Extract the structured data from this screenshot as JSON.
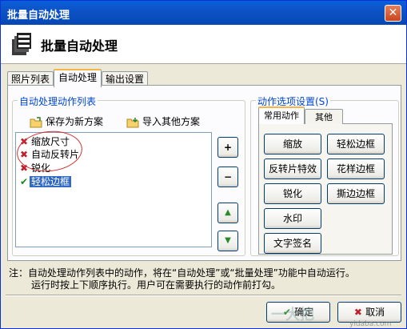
{
  "window": {
    "title": "批量自动处理",
    "close_glyph": "✕"
  },
  "header": {
    "title": "批量自动处理",
    "icon": "batch-process-icon"
  },
  "tabs": [
    {
      "label": "照片列表",
      "active": false
    },
    {
      "label": "自动处理",
      "active": true
    },
    {
      "label": "输出设置",
      "active": false
    }
  ],
  "left_group": {
    "legend": "自动处理动作列表",
    "save_label": "保存为新方案",
    "import_label": "导入其他方案",
    "actions": [
      {
        "label": "缩放尺寸",
        "status": "disabled",
        "mark": "✖"
      },
      {
        "label": "自动反转片",
        "status": "disabled",
        "mark": "✖"
      },
      {
        "label": "锐化",
        "status": "disabled",
        "mark": "✖"
      },
      {
        "label": "轻松边框",
        "status": "enabled",
        "mark": "✔",
        "selected": true
      }
    ],
    "side_buttons": {
      "add": "+",
      "remove": "−",
      "up": "▲",
      "down": "▼"
    }
  },
  "right_group": {
    "legend": "动作选项设置(S)",
    "subtabs": [
      {
        "label": "常用动作",
        "active": true
      },
      {
        "label": "其他",
        "active": false
      }
    ],
    "buttons": {
      "scale": "缩放",
      "easy_border": "轻松边框",
      "reverse_film": "反转片特效",
      "pattern_border": "花样边框",
      "sharpen": "锐化",
      "torn_border": "撕边边框",
      "watermark": "水印",
      "text_signature": "文字签名"
    }
  },
  "note": {
    "line1": "注：自动处理动作列表中的动作，将在“自动处理”或“批量处理”功能中自动运行。",
    "line2": "运行时按上下顺序执行。用户可在需要执行的动作前打勾。"
  },
  "footer": {
    "ok_label": "确定",
    "cancel_label": "取消"
  },
  "watermark": {
    "text": "一大把",
    "url_text": "yidaba.com"
  },
  "colors": {
    "titlebar": "#0a5fd8",
    "selection": "#316ac5",
    "disabled_mark": "#c0202a",
    "enabled_mark": "#1e8a1e",
    "circle": "#d23030"
  }
}
